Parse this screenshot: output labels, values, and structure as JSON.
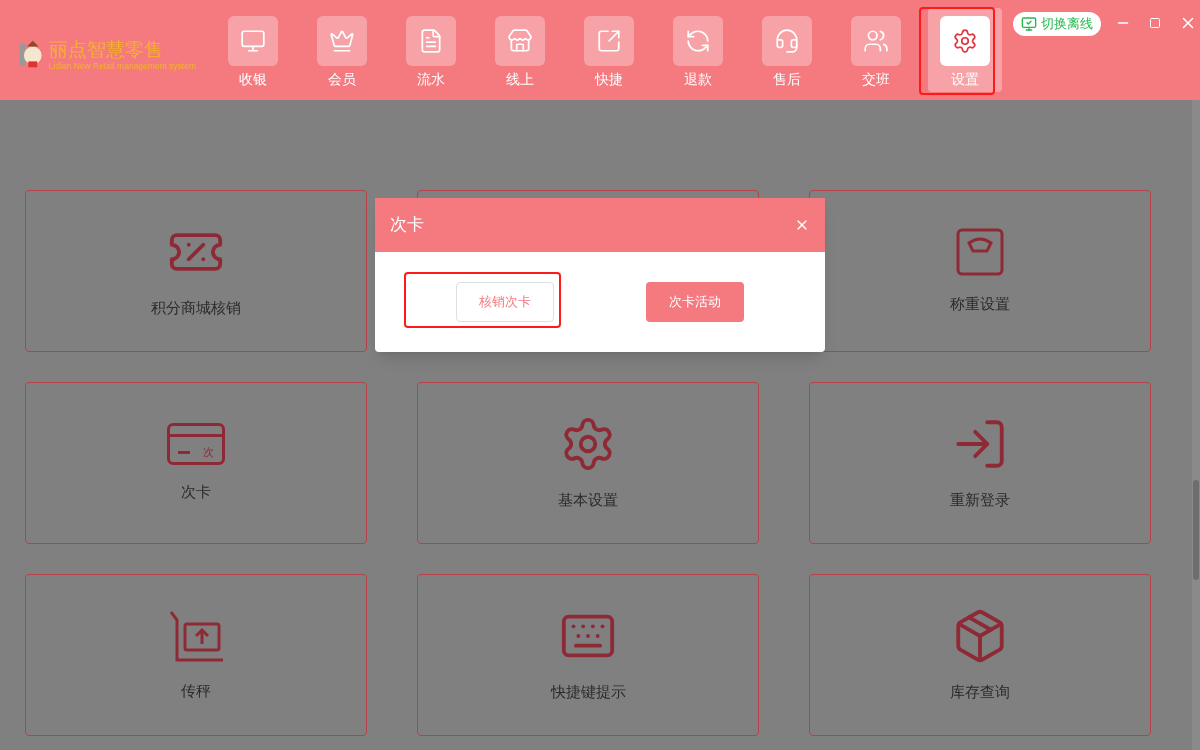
{
  "app": {
    "logo_title": "丽点智慧零售",
    "logo_subtitle": "Lidian New Retail management system"
  },
  "nav": [
    {
      "label": "收银",
      "selected": false,
      "highlighted": false
    },
    {
      "label": "会员",
      "selected": false,
      "highlighted": false
    },
    {
      "label": "流水",
      "selected": false,
      "highlighted": false
    },
    {
      "label": "线上",
      "selected": false,
      "highlighted": false
    },
    {
      "label": "快捷",
      "selected": false,
      "highlighted": false
    },
    {
      "label": "退款",
      "selected": false,
      "highlighted": false
    },
    {
      "label": "售后",
      "selected": false,
      "highlighted": false
    },
    {
      "label": "交班",
      "selected": false,
      "highlighted": false
    },
    {
      "label": "设置",
      "selected": true,
      "highlighted": true
    }
  ],
  "offline_button": "切换离线",
  "tiles": [
    {
      "kind": "tile",
      "label": "积分商城核销"
    },
    {
      "kind": "covered"
    },
    {
      "kind": "tile",
      "label": "称重设置"
    },
    {
      "kind": "tile",
      "label": "次卡",
      "icon_text": "次"
    },
    {
      "kind": "tile",
      "label": "基本设置"
    },
    {
      "kind": "tile",
      "label": "重新登录"
    },
    {
      "kind": "tile",
      "label": "传秤"
    },
    {
      "kind": "tile",
      "label": "快捷键提示"
    },
    {
      "kind": "tile",
      "label": "库存查询"
    }
  ],
  "dialog": {
    "title": "次卡",
    "buttons": [
      {
        "label": "核销次卡",
        "kind": "outline",
        "highlighted": true
      },
      {
        "label": "次卡活动",
        "kind": "primary",
        "highlighted": false
      }
    ]
  }
}
